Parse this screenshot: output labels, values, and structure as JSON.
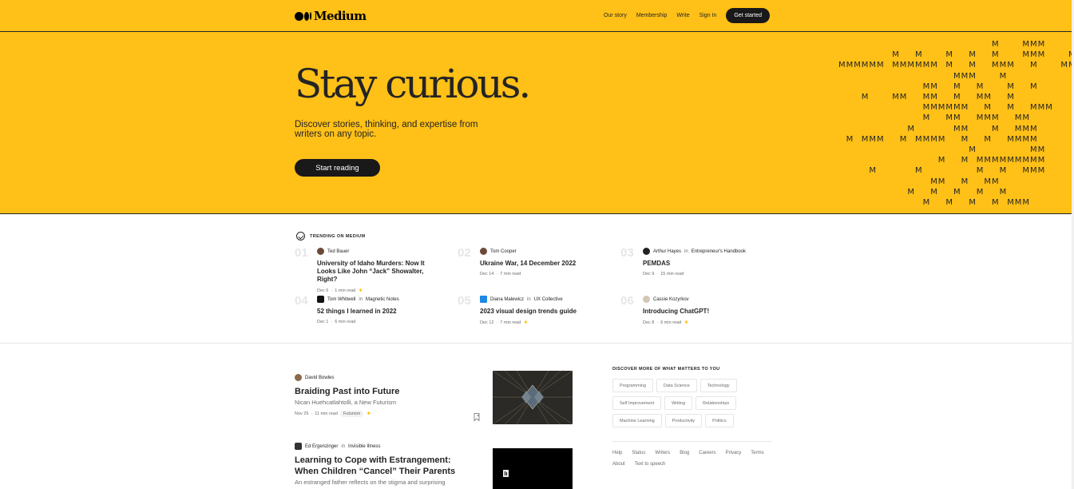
{
  "header": {
    "logo_text": "Medium",
    "nav": [
      "Our story",
      "Membership",
      "Write",
      "Sign In"
    ],
    "cta": "Get started"
  },
  "hero": {
    "title": "Stay curious.",
    "subtitle": "Discover stories, thinking, and expertise from writers on any topic.",
    "button": "Start reading"
  },
  "trending": {
    "heading": "TRENDING ON MEDIUM",
    "items": [
      {
        "num": "01",
        "author": "Ted Bauer",
        "pub": "",
        "title": "University of Idaho Murders: Now It Looks Like John “Jack” Showalter, Right?",
        "date": "Dec 6",
        "read": "1 min read",
        "star": true
      },
      {
        "num": "02",
        "author": "Tom Cooper",
        "pub": "",
        "title": "Ukraine War, 14 December 2022",
        "date": "Dec 14",
        "read": "7 min read",
        "star": false
      },
      {
        "num": "03",
        "author": "Arthur Hayes",
        "pub": "Entrepreneur's Handbook",
        "title": "PEMDAS",
        "date": "Dec 9",
        "read": "15 min read",
        "star": false
      },
      {
        "num": "04",
        "author": "Tom Whitwell",
        "pub": "Magnetic Notes",
        "title": "52 things I learned in 2022",
        "date": "Dec 1",
        "read": "6 min read",
        "star": false
      },
      {
        "num": "05",
        "author": "Diana Malewicz",
        "pub": "UX Collective",
        "title": "2023 visual design trends guide",
        "date": "Dec 12",
        "read": "7 min read",
        "star": true
      },
      {
        "num": "06",
        "author": "Cassie Kozyrkov",
        "pub": "",
        "title": "Introducing ChatGPT!",
        "date": "Dec 8",
        "read": "6 min read",
        "star": true
      }
    ],
    "in_word": "in",
    "dot": "·"
  },
  "feed": [
    {
      "author": "David Bowles",
      "pub": "",
      "title": "Braiding Past into Future",
      "subtitle": "Nican Huehcatlahtolli, a New Futurism",
      "date": "Nov 25",
      "read": "11 min read",
      "tag": "Futurism"
    },
    {
      "author": "Ed Ergenzinger",
      "pub": "Invisible Illness",
      "title": "Learning to Cope with Estrangement: When Children “Cancel” Their Parents",
      "subtitle": "An estranged father reflects on the stigma and surprising",
      "date": "",
      "read": "",
      "tag": ""
    }
  ],
  "sidebar": {
    "heading": "DISCOVER MORE OF WHAT MATTERS TO YOU",
    "topics": [
      "Programming",
      "Data Science",
      "Technology",
      "Self Improvement",
      "Writing",
      "Relationships",
      "Machine Learning",
      "Productivity",
      "Politics"
    ],
    "footer": [
      "Help",
      "Status",
      "Writers",
      "Blog",
      "Careers",
      "Privacy",
      "Terms",
      "About",
      "Text to speech"
    ]
  },
  "pattern_glyph": "M",
  "colors": {
    "brand_yellow": "#ffc017",
    "ink": "#242424",
    "muted": "#6b6b6b"
  }
}
